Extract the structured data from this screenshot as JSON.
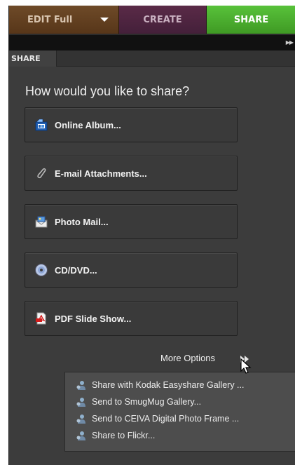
{
  "tabs": {
    "edit_label": "EDIT Full",
    "create_label": "CREATE",
    "share_label": "SHARE"
  },
  "panel": {
    "tab_label": "SHARE",
    "question": "How would you like to share?"
  },
  "share_options": [
    {
      "label": "Online Album...",
      "icon": "online-album-icon"
    },
    {
      "label": "E-mail Attachments...",
      "icon": "paperclip-icon"
    },
    {
      "label": "Photo Mail...",
      "icon": "photo-mail-icon"
    },
    {
      "label": "CD/DVD...",
      "icon": "disc-icon"
    },
    {
      "label": "PDF Slide Show...",
      "icon": "pdf-icon"
    }
  ],
  "more_options": {
    "label": "More Options",
    "items": [
      "Share with Kodak Easyshare Gallery ...",
      "Send to SmugMug Gallery...",
      "Send to CEIVA Digital Photo Frame ...",
      "Share to Flickr..."
    ]
  },
  "colors": {
    "share_tab": "#4caf2f",
    "create_tab": "#4f2541",
    "edit_tab": "#633f21",
    "panel_bg": "#3c3c3c"
  }
}
